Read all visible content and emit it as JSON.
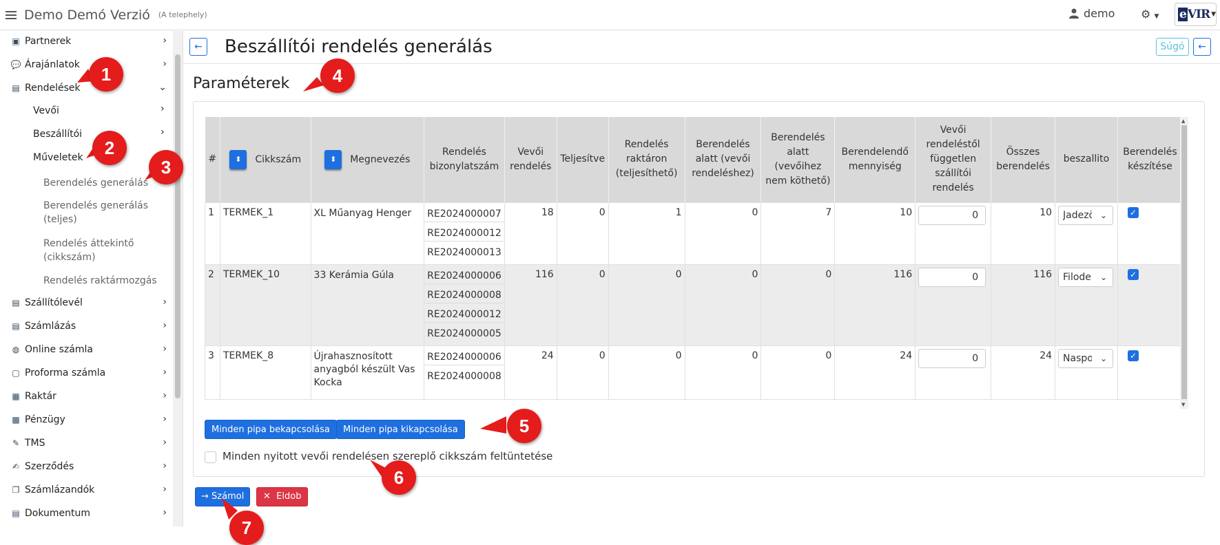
{
  "topbar": {
    "app_title": "Demo Demó Verzió",
    "site": "(A telephely)",
    "user": "demo",
    "logo": "eVIR"
  },
  "sidebar": {
    "items": [
      {
        "label": "Partnerek",
        "icon": "address-book-icon"
      },
      {
        "label": "Árajánlatok",
        "icon": "comments-icon"
      },
      {
        "label": "Rendelések",
        "icon": "file-icon",
        "expanded": true
      },
      {
        "label": "Szállítólevél",
        "icon": "file-icon"
      },
      {
        "label": "Számlázás",
        "icon": "file-invoice-icon"
      },
      {
        "label": "Online számla",
        "icon": "globe-icon"
      },
      {
        "label": "Proforma számla",
        "icon": "sticky-note-icon"
      },
      {
        "label": "Raktár",
        "icon": "warehouse-icon"
      },
      {
        "label": "Pénzügy",
        "icon": "money-icon"
      },
      {
        "label": "TMS",
        "icon": "thumbtack-icon"
      },
      {
        "label": "Szerződés",
        "icon": "file-signature-icon"
      },
      {
        "label": "Számlázandók",
        "icon": "copy-icon"
      },
      {
        "label": "Dokumentum",
        "icon": "file-word-icon"
      }
    ],
    "sub_items": [
      "Vevői",
      "Beszállítói",
      "Műveletek"
    ],
    "sub_sub_items": [
      "Berendelés generálás",
      "Berendelés generálás (teljes)",
      "Rendelés áttekintő (cikkszám)",
      "Rendelés raktármozgás"
    ]
  },
  "page": {
    "title": "Beszállítói rendelés generálás",
    "help": "Súgó",
    "section": "Paraméterek"
  },
  "table": {
    "headers": [
      "#",
      "Cikkszám",
      "Megnevezés",
      "Rendelés bizonylatszám",
      "Vevői rendelés",
      "Teljesítve",
      "Rendelés raktáron (teljesíthető)",
      "Berendelés alatt (vevői rendeléshez)",
      "Berendelés alatt (vevőihez nem köthető)",
      "Berendelendő mennyiség",
      "Vevői rendeléstől független szállítói rendelés",
      "Összes berendelés",
      "beszallito",
      "Berendelés készítése"
    ],
    "rows": [
      {
        "n": "1",
        "code": "TERMEK_1",
        "name": "XL Műanyag Henger",
        "docs": [
          "RE2024000007",
          "RE2024000012",
          "RE2024000013"
        ],
        "vevoi": "18",
        "teljesitve": "0",
        "raktaron": "1",
        "alatt_vevoi": "0",
        "alatt_nem": "7",
        "berendelendo": "10",
        "fuggetlen": "0",
        "osszes": "10",
        "beszallito": "Jadezöld",
        "checked": true
      },
      {
        "n": "2",
        "code": "TERMEK_10",
        "name": "33 Kerámia Gúla",
        "docs": [
          "RE2024000006",
          "RE2024000008",
          "RE2024000012",
          "RE2024000005"
        ],
        "vevoi": "116",
        "teljesitve": "0",
        "raktaron": "0",
        "alatt_vevoi": "0",
        "alatt_nem": "0",
        "berendelendo": "116",
        "fuggetlen": "0",
        "osszes": "116",
        "beszallito": "Filodendron",
        "checked": true
      },
      {
        "n": "3",
        "code": "TERMEK_8",
        "name": "Újrahasznosított anyagból készült Vas Kocka",
        "docs": [
          "RE2024000006",
          "RE2024000008"
        ],
        "vevoi": "24",
        "teljesitve": "0",
        "raktaron": "0",
        "alatt_vevoi": "0",
        "alatt_nem": "0",
        "berendelendo": "24",
        "fuggetlen": "0",
        "osszes": "24",
        "beszallito": "Naspolya",
        "checked": true
      }
    ]
  },
  "actions": {
    "check_all": "Minden pipa bekapcsolása",
    "uncheck_all": "Minden pipa kikapcsolása",
    "show_all_label": "Minden nyitott vevői rendelésen szereplő cikkszám feltüntetése",
    "calc": "Számol",
    "discard": "Eldob"
  },
  "markers": [
    "1",
    "2",
    "3",
    "4",
    "5",
    "6",
    "7"
  ],
  "colors": {
    "primary": "#1e6fe0",
    "danger": "#dc3545",
    "info": "#5bc0de",
    "marker": "#e51c1c"
  }
}
